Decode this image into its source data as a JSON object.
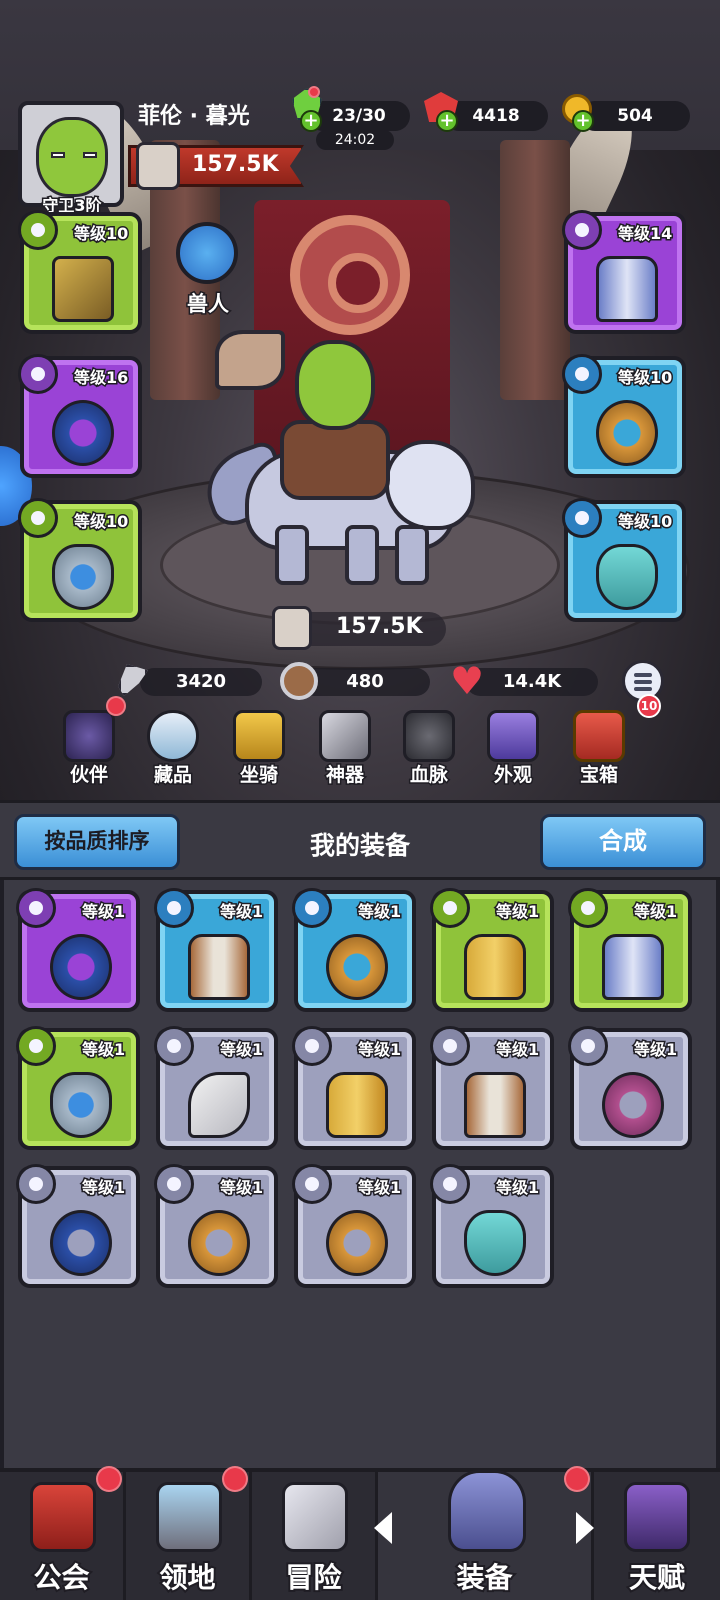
{
  "header": {
    "player_name": "菲伦 · 暮光",
    "rank_label": "守卫3阶",
    "power": "157.5K",
    "stamina": "23/30",
    "stamina_timer": "24:02",
    "gems": "4418",
    "gold": "504"
  },
  "race": {
    "label": "兽人"
  },
  "equipped_slots": [
    {
      "name": "weapon",
      "level": "等级10",
      "rarity": "green",
      "icon": "crossbow-icon"
    },
    {
      "name": "ring",
      "level": "等级16",
      "rarity": "purple",
      "icon": "dark-ring-icon"
    },
    {
      "name": "necklace",
      "level": "等级10",
      "rarity": "green",
      "icon": "amulet-icon"
    },
    {
      "name": "armor",
      "level": "等级14",
      "rarity": "purple",
      "icon": "vest-icon"
    },
    {
      "name": "ring-2",
      "level": "等级10",
      "rarity": "blue",
      "icon": "gold-ring-icon"
    },
    {
      "name": "helmet",
      "level": "等级10",
      "rarity": "blue",
      "icon": "mask-icon"
    }
  ],
  "hero_power": "157.5K",
  "stats": {
    "attack": "3420",
    "defense": "480",
    "hp": "14.4K"
  },
  "quick_menu": [
    {
      "label": "伙伴",
      "icon": "companion-icon",
      "badge": true
    },
    {
      "label": "藏品",
      "icon": "collection-icon"
    },
    {
      "label": "坐骑",
      "icon": "mount-icon"
    },
    {
      "label": "神器",
      "icon": "artifact-icon"
    },
    {
      "label": "血脉",
      "icon": "bloodline-icon"
    },
    {
      "label": "外观",
      "icon": "appearance-icon"
    },
    {
      "label": "宝箱",
      "icon": "chest-icon",
      "badge_count": "10"
    }
  ],
  "inventory": {
    "sort_button": "按品质排序",
    "title": "我的装备",
    "merge_button": "合成",
    "items": [
      {
        "level": "等级1",
        "rarity": "purple",
        "icon": "dark-ring-icon"
      },
      {
        "level": "等级1",
        "rarity": "blue",
        "icon": "shirt-icon"
      },
      {
        "level": "等级1",
        "rarity": "blue",
        "icon": "gold-ring-icon"
      },
      {
        "level": "等级1",
        "rarity": "green",
        "icon": "gold-armor-icon"
      },
      {
        "level": "等级1",
        "rarity": "green",
        "icon": "vest-icon"
      },
      {
        "level": "等级1",
        "rarity": "green",
        "icon": "amulet-icon"
      },
      {
        "level": "等级1",
        "rarity": "gray",
        "icon": "axe-icon"
      },
      {
        "level": "等级1",
        "rarity": "gray",
        "icon": "gold-armor-icon"
      },
      {
        "level": "等级1",
        "rarity": "gray",
        "icon": "shirt-icon"
      },
      {
        "level": "等级1",
        "rarity": "gray",
        "icon": "green-ring-icon"
      },
      {
        "level": "等级1",
        "rarity": "gray",
        "icon": "dark-ring-icon"
      },
      {
        "level": "等级1",
        "rarity": "gray",
        "icon": "gold-ring-icon"
      },
      {
        "level": "等级1",
        "rarity": "gray",
        "icon": "gold-ring-icon"
      },
      {
        "level": "等级1",
        "rarity": "gray",
        "icon": "mask-icon"
      }
    ]
  },
  "bottom_nav": [
    {
      "label": "公会",
      "icon": "guild-icon",
      "badge": true
    },
    {
      "label": "领地",
      "icon": "territory-icon",
      "badge": true
    },
    {
      "label": "冒险",
      "icon": "adventure-icon"
    },
    {
      "label": "装备",
      "icon": "equipment-icon",
      "badge": true,
      "active": true
    },
    {
      "label": "天赋",
      "icon": "talent-icon"
    }
  ],
  "colors": {
    "green": "#8fc33a",
    "purple": "#9a43d6",
    "blue": "#3aa7d8",
    "gray": "#9da0bd",
    "badge_red": "#e8394a"
  }
}
